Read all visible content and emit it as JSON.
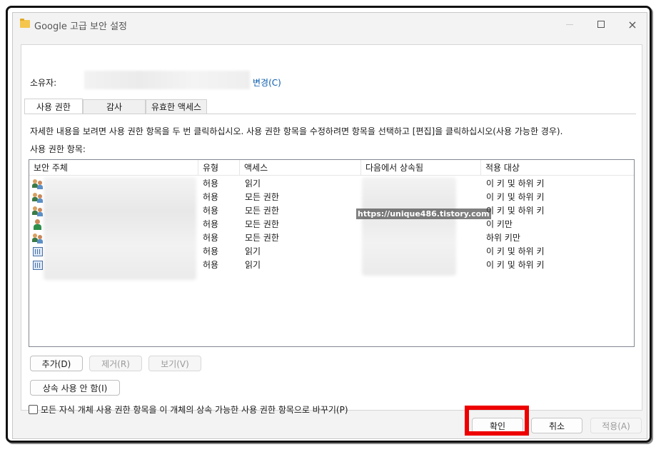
{
  "window": {
    "title": "Google 고급 보안 설정",
    "controls": {
      "minimize": "minimize-icon",
      "maximize": "maximize-icon",
      "close": "×"
    }
  },
  "owner": {
    "label": "소유자:",
    "change_link": "변경(C)"
  },
  "tabs": [
    {
      "label": "사용 권한",
      "active": true
    },
    {
      "label": "감사",
      "active": false
    },
    {
      "label": "유효한 액세스",
      "active": false
    }
  ],
  "instructions": "자세한 내용을 보려면 사용 권한 항목을 두 번 클릭하십시오. 사용 권한 항목을 수정하려면 항목을 선택하고 [편집]을 클릭하십시오(사용 가능한 경우).",
  "entries_label": "사용 권한 항목:",
  "table": {
    "columns": [
      "보안 주체",
      "유형",
      "액세스",
      "다음에서 상속됨",
      "적용 대상"
    ],
    "rows": [
      {
        "icon": "user-group-icon",
        "type": "허용",
        "access": "읽기",
        "applies_to": "이 키 및 하위 키"
      },
      {
        "icon": "user-group-icon",
        "type": "허용",
        "access": "모든 권한",
        "applies_to": "이 키 및 하위 키"
      },
      {
        "icon": "user-group-icon",
        "type": "허용",
        "access": "모든 권한",
        "applies_to": "이 키 및 하위 키"
      },
      {
        "icon": "user-icon",
        "type": "허용",
        "access": "모든 권한",
        "applies_to": "이 키만"
      },
      {
        "icon": "user-group-icon",
        "type": "허용",
        "access": "모든 권한",
        "applies_to": "하위 키만"
      },
      {
        "icon": "app-package-icon",
        "type": "허용",
        "access": "읽기",
        "applies_to": "이 키 및 하위 키"
      },
      {
        "icon": "app-package-icon",
        "type": "허용",
        "access": "읽기",
        "applies_to": "이 키 및 하위 키"
      }
    ]
  },
  "watermark": "https://unique486.tistory.com",
  "actions": {
    "add": "추가(D)",
    "remove": "제거(R)",
    "view": "보기(V)"
  },
  "disable_inheritance": "상속 사용 안 함(I)",
  "replace_checkbox": "모든 자식 개체 사용 권한 항목을 이 개체의 상속 가능한 사용 권한 항목으로 바꾸기(P)",
  "footer": {
    "ok": "확인",
    "cancel": "취소",
    "apply": "적용(A)"
  },
  "colors": {
    "highlight": "#ee0000",
    "link": "#0b5cad"
  }
}
